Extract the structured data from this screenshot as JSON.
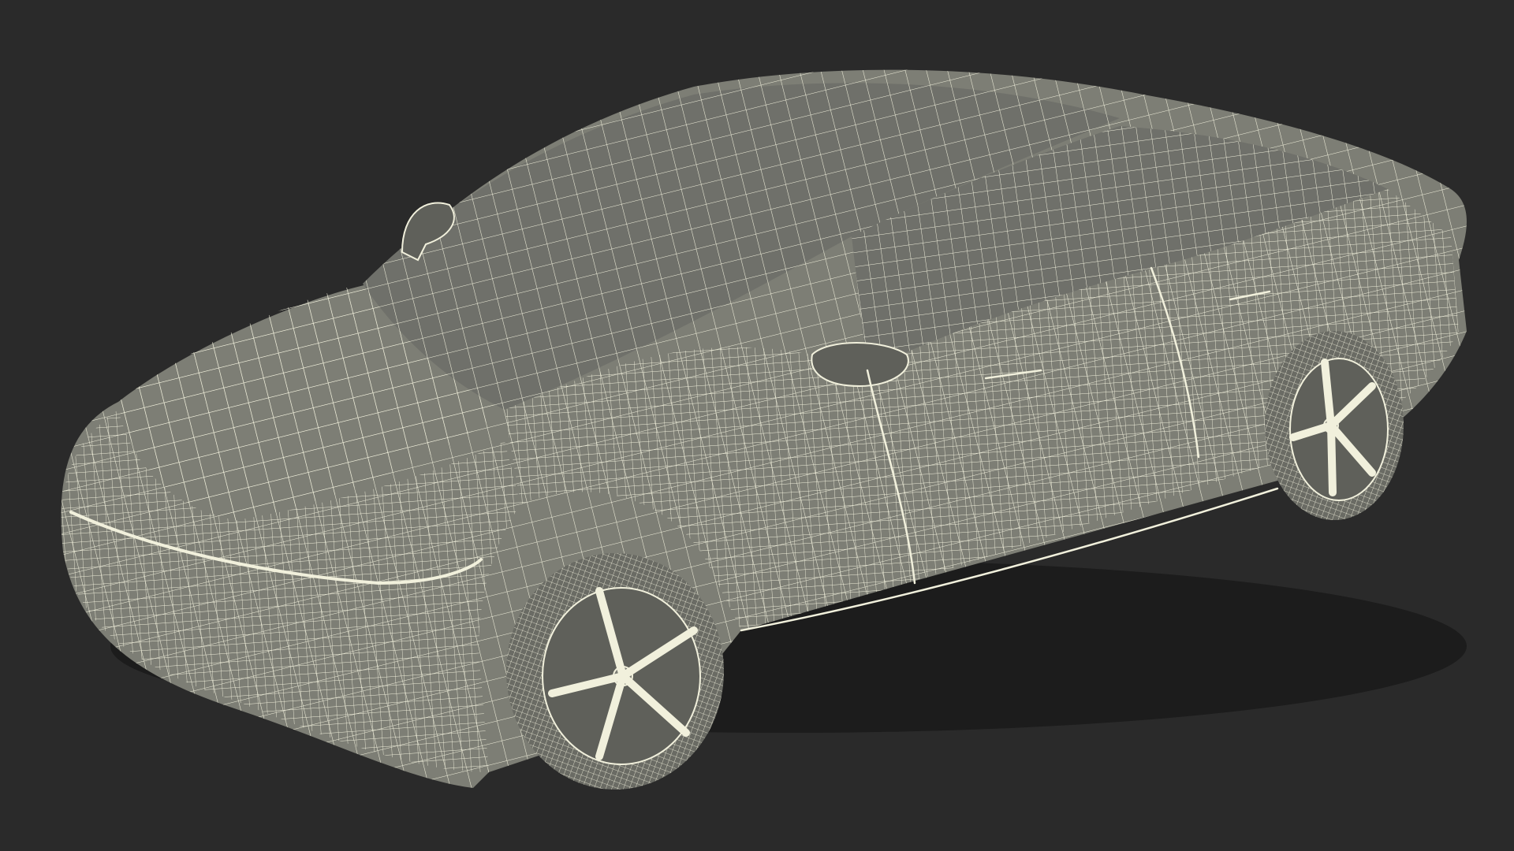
{
  "scene": {
    "subject": "wireframe-car",
    "colors": {
      "background": "#2a2a2a",
      "body_fill": "#7d7e75",
      "body_dark": "#5f605a",
      "glass_fill": "#6f706a",
      "tire_fill": "#6a6b64",
      "wire": "#f1f0dc",
      "shadow": "#1c1c1c"
    }
  }
}
